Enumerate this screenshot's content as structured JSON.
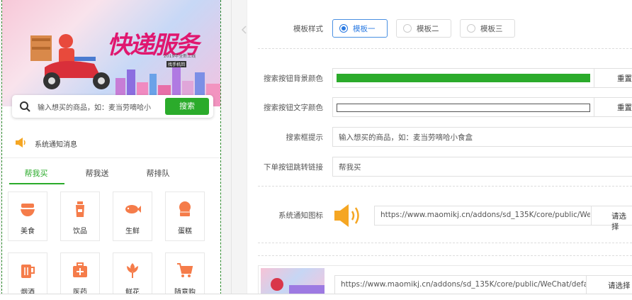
{
  "preview": {
    "banner_title": "快递服务",
    "banner_sub": "2019年全新上线",
    "banner_sub2": "找手机回",
    "search_placeholder": "输入想买的商品，如：麦当劳嘀哈小",
    "search_button": "搜索",
    "notice_text": "系统通知消息",
    "tabs": [
      "帮我买",
      "帮我送",
      "帮排队"
    ],
    "grid": [
      {
        "label": "美食",
        "icon": "food-bowl-icon"
      },
      {
        "label": "饮品",
        "icon": "drink-cup-icon"
      },
      {
        "label": "生鲜",
        "icon": "fish-icon"
      },
      {
        "label": "蛋糕",
        "icon": "cake-icon"
      },
      {
        "label": "烟酒",
        "icon": "beer-mug-icon"
      },
      {
        "label": "医药",
        "icon": "medicine-kit-icon"
      },
      {
        "label": "鲜花",
        "icon": "flower-icon"
      },
      {
        "label": "随意购",
        "icon": "shopping-cart-icon"
      }
    ]
  },
  "form": {
    "template_label": "模板样式",
    "template_options": [
      "模板一",
      "模板二",
      "模板三"
    ],
    "template_selected": "模板一",
    "bg_color_label": "搜索按钮背景颜色",
    "bg_color_value": "#2bab2b",
    "bg_reset": "重置",
    "text_color_label": "搜索按钮文字颜色",
    "text_color_value": "#ffffff",
    "text_reset": "重置",
    "hint_label": "搜索框提示",
    "hint_value": "输入想买的商品，如：麦当劳嘀哈小食盒",
    "link_label": "下单按钮跳转链接",
    "link_value": "帮我买",
    "notice_icon_label": "系统通知图标",
    "notice_icon_url": "https://www.maomikj.cn/addons/sd_135K/core/public/WeCha",
    "notice_icon_choose": "请选择",
    "banner_url": "https://www.maomikj.cn/addons/sd_135K/core/public/WeChat/default/h",
    "banner_choose": "请选择"
  },
  "colors": {
    "accent_green": "#2bab2b",
    "selected_blue": "#2a7ae2",
    "speaker_orange": "#f5a623"
  }
}
